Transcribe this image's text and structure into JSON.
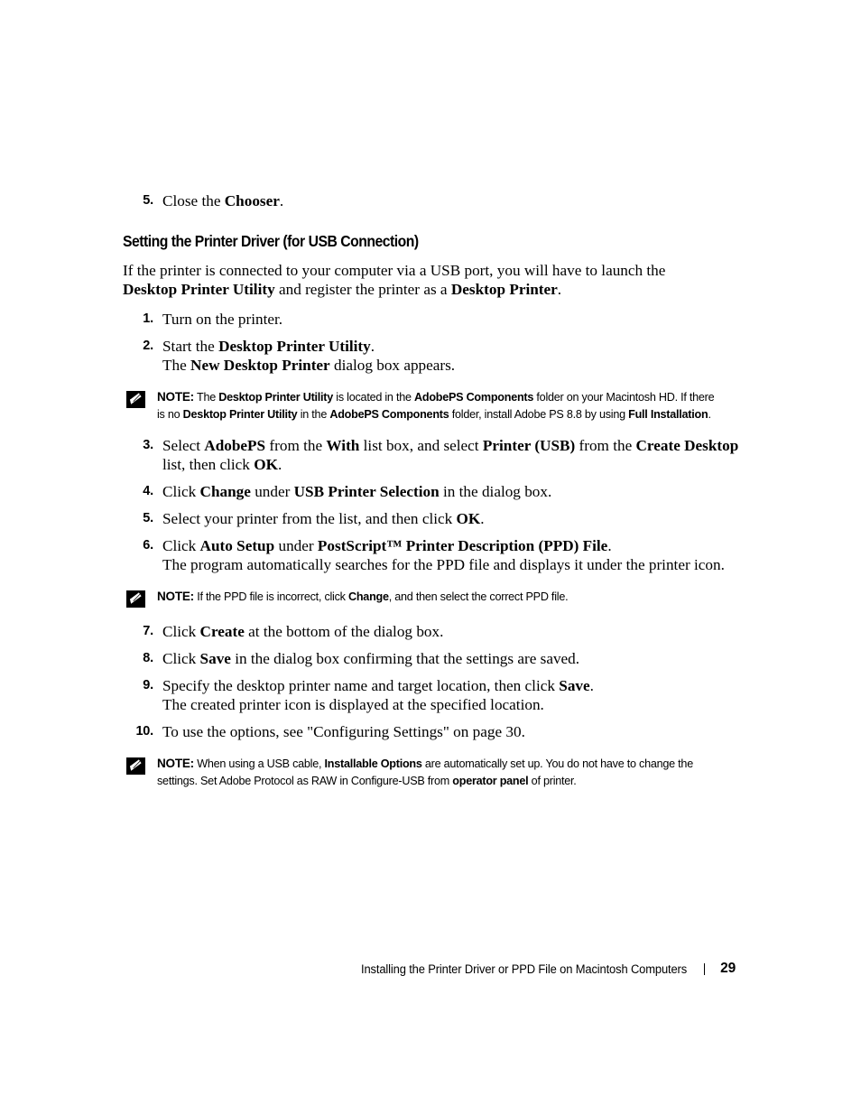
{
  "document": {
    "page_number": "29",
    "footer_title": "Installing the Printer Driver or PPD File on Macintosh Computers"
  },
  "top_step": {
    "number": "5.",
    "text_1": "Close the ",
    "bold_1": "Chooser",
    "text_2": "."
  },
  "section": {
    "heading": "Setting the Printer Driver (for USB Connection)",
    "intro": {
      "t1": "If the printer is connected to your computer via a USB port, you will have to launch the ",
      "b1": "Desktop Printer Utility",
      "t2": " and register the printer as a ",
      "b2": "Desktop Printer",
      "t3": "."
    }
  },
  "steps": [
    {
      "number": "1.",
      "parts": [
        {
          "type": "text",
          "value": "Turn on the printer."
        }
      ]
    },
    {
      "number": "2.",
      "parts": [
        {
          "type": "text",
          "value": "Start the "
        },
        {
          "type": "bold",
          "value": "Desktop Printer Utility"
        },
        {
          "type": "text",
          "value": "."
        },
        {
          "type": "break"
        },
        {
          "type": "text",
          "value": "The "
        },
        {
          "type": "bold",
          "value": "New Desktop Printer"
        },
        {
          "type": "text",
          "value": " dialog box appears."
        }
      ]
    },
    {
      "number": "3.",
      "parts": [
        {
          "type": "text",
          "value": "Select "
        },
        {
          "type": "bold",
          "value": "AdobePS"
        },
        {
          "type": "text",
          "value": " from the "
        },
        {
          "type": "bold",
          "value": "With"
        },
        {
          "type": "text",
          "value": " list box, and select "
        },
        {
          "type": "bold",
          "value": "Printer (USB)"
        },
        {
          "type": "text",
          "value": " from the "
        },
        {
          "type": "bold",
          "value": "Create Desktop"
        },
        {
          "type": "text",
          "value": " list, then click "
        },
        {
          "type": "bold",
          "value": "OK"
        },
        {
          "type": "text",
          "value": "."
        }
      ]
    },
    {
      "number": "4.",
      "parts": [
        {
          "type": "text",
          "value": "Click "
        },
        {
          "type": "bold",
          "value": "Change"
        },
        {
          "type": "text",
          "value": " under "
        },
        {
          "type": "bold",
          "value": "USB Printer Selection"
        },
        {
          "type": "text",
          "value": " in the dialog box."
        }
      ]
    },
    {
      "number": "5.",
      "parts": [
        {
          "type": "text",
          "value": "Select your printer from the list, and then click "
        },
        {
          "type": "bold",
          "value": "OK"
        },
        {
          "type": "text",
          "value": "."
        }
      ]
    },
    {
      "number": "6.",
      "parts": [
        {
          "type": "text",
          "value": "Click "
        },
        {
          "type": "bold",
          "value": "Auto Setup"
        },
        {
          "type": "text",
          "value": " under "
        },
        {
          "type": "bold",
          "value": "PostScript™ Printer Description (PPD) File"
        },
        {
          "type": "text",
          "value": "."
        },
        {
          "type": "break"
        },
        {
          "type": "text",
          "value": "The program automatically searches for the PPD file and displays it under the printer icon."
        }
      ]
    },
    {
      "number": "7.",
      "parts": [
        {
          "type": "text",
          "value": "Click "
        },
        {
          "type": "bold",
          "value": "Create"
        },
        {
          "type": "text",
          "value": " at the bottom of the dialog box."
        }
      ]
    },
    {
      "number": "8.",
      "parts": [
        {
          "type": "text",
          "value": "Click "
        },
        {
          "type": "bold",
          "value": "Save"
        },
        {
          "type": "text",
          "value": " in the dialog box confirming that the settings are saved."
        }
      ]
    },
    {
      "number": "9.",
      "parts": [
        {
          "type": "text",
          "value": "Specify the desktop printer name and target location, then click "
        },
        {
          "type": "bold",
          "value": "Save"
        },
        {
          "type": "text",
          "value": "."
        },
        {
          "type": "break"
        },
        {
          "type": "text",
          "value": "The created printer icon is displayed at the specified location."
        }
      ]
    },
    {
      "number": "10.",
      "parts": [
        {
          "type": "text",
          "value": "To use the options, see \"Configuring Settings\" on page 30."
        }
      ]
    }
  ],
  "notes": [
    {
      "label": "NOTE:",
      "parts": [
        {
          "type": "text",
          "value": " The "
        },
        {
          "type": "bold",
          "value": "Desktop Printer Utility"
        },
        {
          "type": "text",
          "value": " is located in the "
        },
        {
          "type": "bold",
          "value": "AdobePS Components"
        },
        {
          "type": "text",
          "value": " folder on your Macintosh HD. If there is no "
        },
        {
          "type": "bold",
          "value": "Desktop Printer Utility"
        },
        {
          "type": "text",
          "value": " in the "
        },
        {
          "type": "bold",
          "value": "AdobePS Components"
        },
        {
          "type": "text",
          "value": " folder, install Adobe PS 8.8 by using "
        },
        {
          "type": "bold",
          "value": "Full Installation"
        },
        {
          "type": "text",
          "value": "."
        }
      ]
    },
    {
      "label": "NOTE:",
      "parts": [
        {
          "type": "text",
          "value": " If the PPD file is incorrect, click "
        },
        {
          "type": "bold",
          "value": "Change"
        },
        {
          "type": "text",
          "value": ", and then select the correct PPD file."
        }
      ]
    },
    {
      "label": "NOTE:",
      "parts": [
        {
          "type": "text",
          "value": " When using a USB cable, "
        },
        {
          "type": "bold",
          "value": "Installable Options"
        },
        {
          "type": "text",
          "value": " are automatically set up. You do not have to change the settings. Set Adobe Protocol as RAW in Configure-USB from "
        },
        {
          "type": "bold",
          "value": "operator panel"
        },
        {
          "type": "text",
          "value": " of printer."
        }
      ]
    }
  ],
  "icons": {
    "note": "pencil-note-icon"
  }
}
